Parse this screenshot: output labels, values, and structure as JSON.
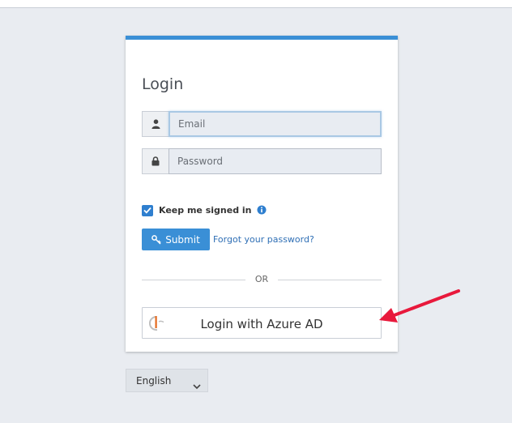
{
  "login": {
    "title": "Login",
    "email": {
      "placeholder": "Email",
      "value": ""
    },
    "password": {
      "placeholder": "Password",
      "value": ""
    },
    "remember": {
      "label": "Keep me signed in",
      "checked": true
    },
    "submit_label": "Submit",
    "forgot_label": "Forgot your password?",
    "divider_label": "OR",
    "sso_label": "Login with Azure AD"
  },
  "language": {
    "selected": "English"
  },
  "colors": {
    "accent": "#3a8fd6",
    "arrow": "#e8193c"
  },
  "icons": [
    "user-icon",
    "lock-icon",
    "check-icon",
    "info-icon",
    "key-icon",
    "azure-logo-icon",
    "chevron-down-icon"
  ]
}
